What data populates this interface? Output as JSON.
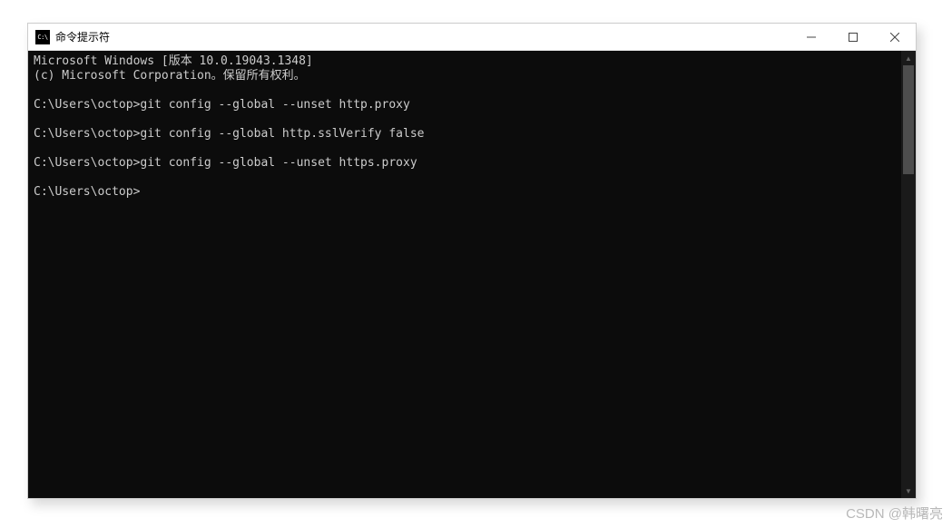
{
  "window": {
    "title": "命令提示符",
    "icon_label": "C:\\"
  },
  "terminal": {
    "lines": [
      "Microsoft Windows [版本 10.0.19043.1348]",
      "(c) Microsoft Corporation。保留所有权利。",
      "",
      "C:\\Users\\octop>git config --global --unset http.proxy",
      "",
      "C:\\Users\\octop>git config --global http.sslVerify false",
      "",
      "C:\\Users\\octop>git config --global --unset https.proxy",
      "",
      "C:\\Users\\octop>"
    ]
  },
  "watermark": "CSDN @韩曙亮"
}
